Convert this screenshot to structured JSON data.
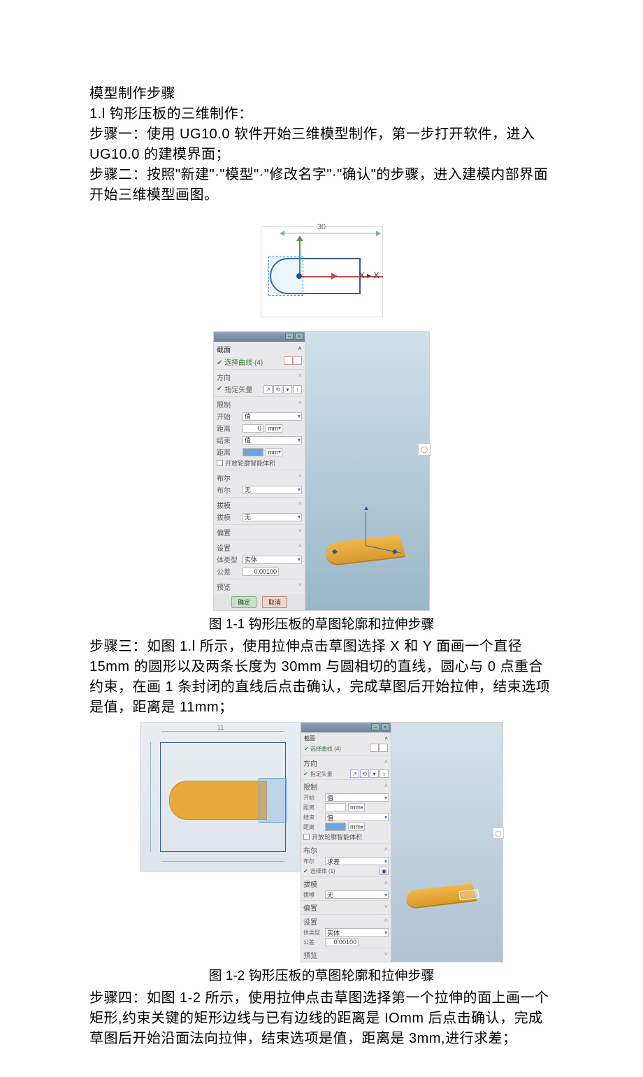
{
  "heading": "模型制作步骤",
  "sec1_title": "1.l 钩形压板的三维制作：",
  "step1": "步骤一：使用 UG10.0 软件开始三维模型制作，第一步打开软件，进入 UG10.0 的建模界面；",
  "step2": "步骤二：按照\"新建\"·\"模型\"·\"修改名字\"·\"确认\"的步骤，进入建模内部界面开始三维模型画图。",
  "fig1_dim": "30",
  "fig1_axis_x": "X",
  "fig1_axis_x2": "X",
  "caption1": "图 1-1 钩形压板的草图轮廓和拉伸步骤",
  "step3": "步骤三：如图 1.l 所示，使用拉伸点击草图选择 X 和 Y 面画一个直径 15mm 的圆形以及两条长度为 30mm 与圆相切的直线，圆心与 0 点重合约束，在画 1 条封闭的直线后点击确认，完成草图后开始拉伸，结束选项是值，距离是 11mm；",
  "caption2": "图 1-2 钩形压板的草图轮廓和拉伸步骤",
  "step4": "步骤四：如图 1-2 所示，使用拉伸点击草图选择第一个拉伸的面上画一个矩形,约束关键的矩形边线与已有边线的距离是 IOmm 后点击确认，完成草图后开始沿面法向拉伸，结束选项是值，距离是 3mm,进行求差；",
  "panel": {
    "section_label": "截面",
    "select_curve": "选择曲线 (4)",
    "direction": "方向",
    "spec_vector": "指定矢量",
    "limits": "限制",
    "start": "开始",
    "distance": "距离",
    "end": "结束",
    "value_opt": "值",
    "dist_val0": "0",
    "dist_unit": "mm",
    "open_chk": "开放轮廓智能体积",
    "bool_sec": "布尔",
    "bool_label": "布尔",
    "bool_none": "无",
    "bool_sub": "求差",
    "select_body": "选择体 (1)",
    "draft": "拔模",
    "draft_label": "拔模",
    "draft_none": "无",
    "offset": "偏置",
    "settings": "设置",
    "body_type": "体类型",
    "solid": "实体",
    "tol_label": "公差",
    "tol_val": "0.00100",
    "preview": "预览",
    "ok": "确定",
    "cancel": "取消"
  },
  "fig2": {
    "top_dim": "11"
  }
}
